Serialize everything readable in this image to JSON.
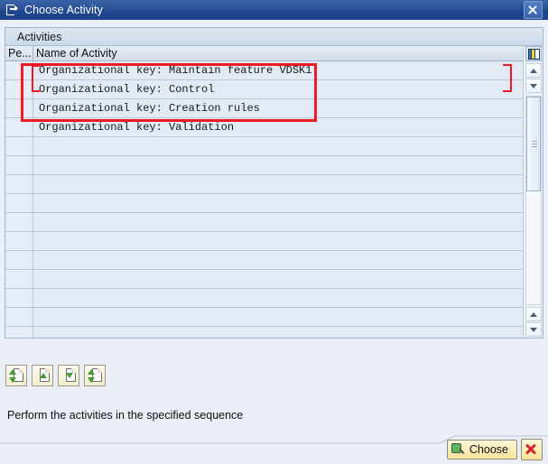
{
  "window": {
    "title": "Choose Activity",
    "title_icon": "dialog-window-icon",
    "close_icon": "close-icon"
  },
  "panel": {
    "caption": "Activities",
    "columns": [
      {
        "key": "pe",
        "label": "Pe..."
      },
      {
        "key": "name",
        "label": "Name of Activity"
      }
    ],
    "rows": [
      {
        "pe": "",
        "name": "Organizational key: Maintain feature VDSK1"
      },
      {
        "pe": "",
        "name": "Organizational key: Control"
      },
      {
        "pe": "",
        "name": "Organizational key: Creation rules"
      },
      {
        "pe": "",
        "name": "Organizational key: Validation"
      },
      {
        "pe": "",
        "name": ""
      },
      {
        "pe": "",
        "name": ""
      },
      {
        "pe": "",
        "name": ""
      },
      {
        "pe": "",
        "name": ""
      },
      {
        "pe": "",
        "name": ""
      },
      {
        "pe": "",
        "name": ""
      },
      {
        "pe": "",
        "name": ""
      },
      {
        "pe": "",
        "name": ""
      },
      {
        "pe": "",
        "name": ""
      },
      {
        "pe": "",
        "name": ""
      },
      {
        "pe": "",
        "name": ""
      }
    ],
    "config_icon": "column-settings-icon",
    "scroll": {
      "up_icon": "scroll-up-icon",
      "down_icon": "scroll-down-icon",
      "page_up_icon": "page-up-icon",
      "page_down_icon": "page-down-icon",
      "thumb_icon": "scrollbar-thumb"
    }
  },
  "toolbar": {
    "buttons": [
      {
        "name": "first-activity-button",
        "icon": "document-first-icon"
      },
      {
        "name": "previous-activity-button",
        "icon": "document-up-icon"
      },
      {
        "name": "next-activity-button",
        "icon": "document-down-icon"
      },
      {
        "name": "last-activity-button",
        "icon": "document-last-icon"
      }
    ]
  },
  "footer": {
    "hint": "Perform the activities in the specified sequence",
    "choose_label": "Choose",
    "choose_icon": "magnifier-icon",
    "cancel_icon": "cancel-x-icon"
  },
  "colors": {
    "title_bar": "#2b5298",
    "dialog_bg": "#eaeff7",
    "grid_row": "#e2eaf4",
    "annotation": "#ee1b24",
    "button_yellow": "#f6e49a"
  }
}
